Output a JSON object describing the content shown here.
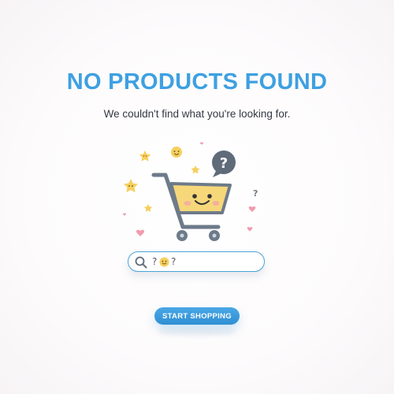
{
  "empty_state": {
    "title": "NO PRODUCTS FOUND",
    "message": "We couldn't find what you're looking for."
  },
  "search": {
    "value_prefix": "?",
    "value_suffix": "?",
    "icon": "search-icon",
    "emoji": "smiley-face-icon"
  },
  "cta": {
    "label": "START SHOPPING"
  },
  "illustration": {
    "icons": [
      "shopping-cart-icon",
      "question-bubble-icon",
      "star-icon",
      "heart-icon",
      "smiley-face-icon"
    ]
  },
  "colors": {
    "accent": "#3ea0e1",
    "cart_body": "#f6d77a",
    "cart_frame": "#6d7a89",
    "bubble": "#5f6b79",
    "heart": "#f19bb0",
    "star": "#f6cf5d"
  }
}
